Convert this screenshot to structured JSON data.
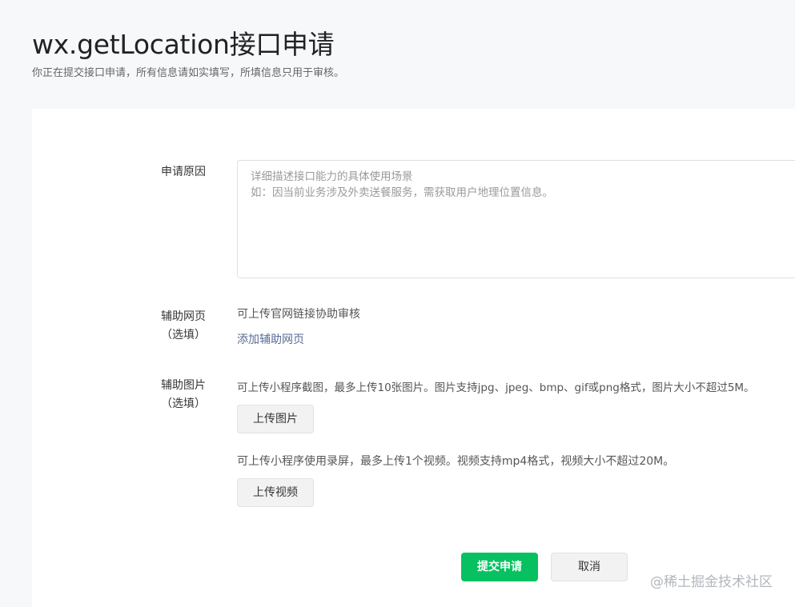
{
  "header": {
    "title": "wx.getLocation接口申请",
    "subtitle": "你正在提交接口申请，所有信息请如实填写，所填信息只用于审核。"
  },
  "form": {
    "reason": {
      "label": "申请原因",
      "placeholder_line1": "详细描述接口能力的具体使用场景",
      "placeholder_line2": "如：因当前业务涉及外卖送餐服务，需获取用户地理位置信息。"
    },
    "web_page": {
      "label": "辅助网页",
      "optional": "（选填）",
      "hint": "可上传官网链接协助审核",
      "add_link": "添加辅助网页"
    },
    "images": {
      "label": "辅助图片",
      "optional": "（选填）",
      "image_hint": "可上传小程序截图，最多上传10张图片。图片支持jpg、jpeg、bmp、gif或png格式，图片大小不超过5M。",
      "upload_image": "上传图片",
      "video_hint": "可上传小程序使用录屏，最多上传1个视频。视频支持mp4格式，视频大小不超过20M。",
      "upload_video": "上传视频"
    }
  },
  "actions": {
    "submit": "提交申请",
    "cancel": "取消"
  },
  "watermark": "@稀土掘金技术社区",
  "colors": {
    "primary": "#07c160",
    "link": "#576b95",
    "background": "#f7f8fa"
  }
}
